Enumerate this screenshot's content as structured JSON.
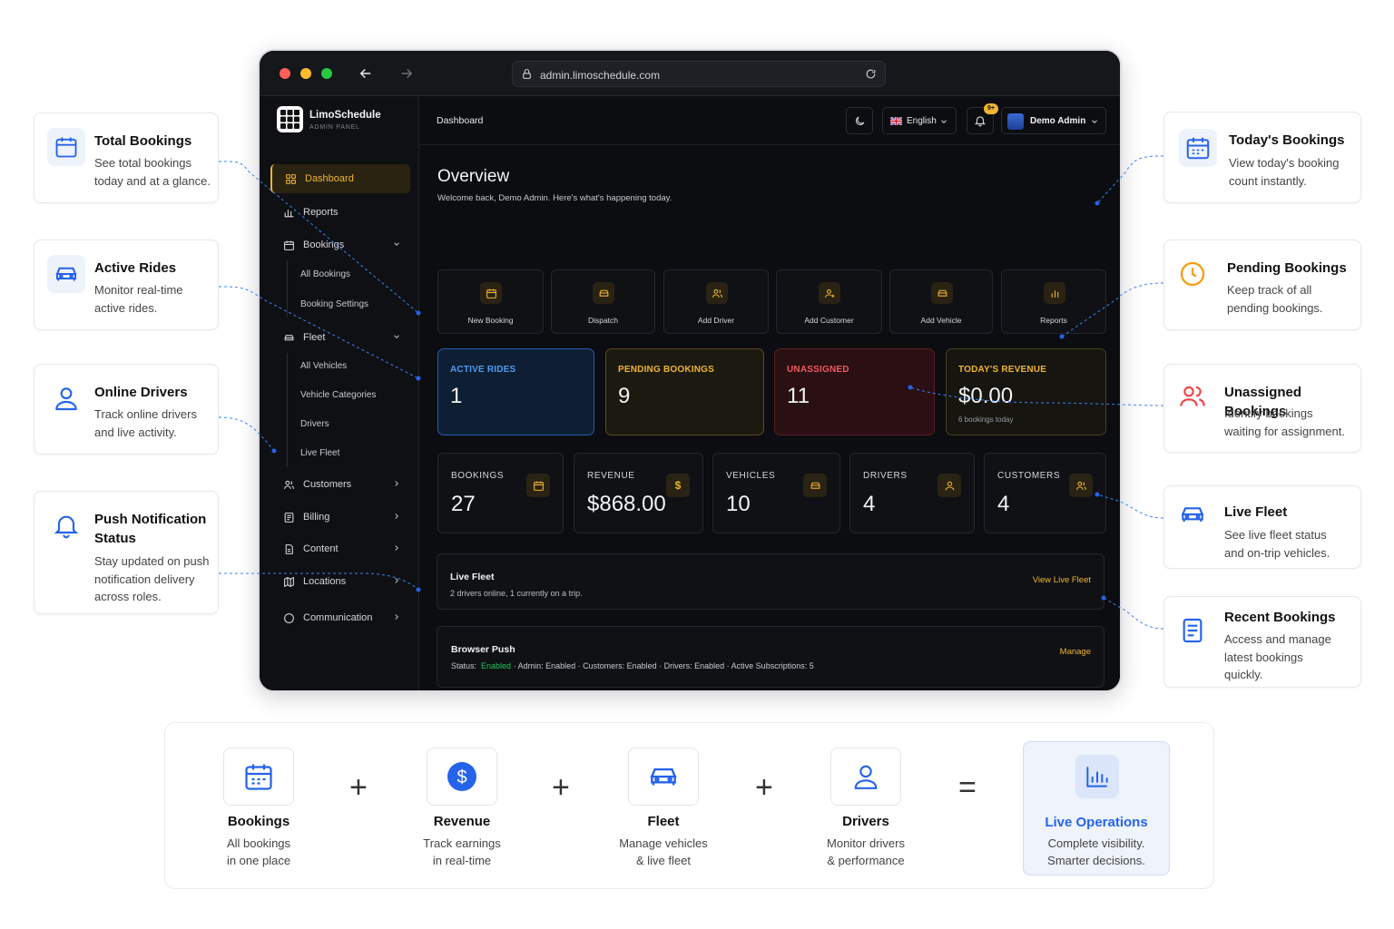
{
  "browser": {
    "url": "admin.limoschedule.com"
  },
  "brand": {
    "name": "LimoSchedule",
    "subtitle": "ADMIN PANEL"
  },
  "topbar": {
    "breadcrumb": "Dashboard",
    "language": "English",
    "notification_badge": "9+",
    "user": "Demo Admin"
  },
  "sidebar": {
    "dashboard": "Dashboard",
    "reports": "Reports",
    "bookings": "Bookings",
    "all_bookings": "All Bookings",
    "booking_settings": "Booking Settings",
    "fleet": "Fleet",
    "all_vehicles": "All Vehicles",
    "vehicle_categories": "Vehicle Categories",
    "drivers": "Drivers",
    "live_fleet": "Live Fleet",
    "customers": "Customers",
    "billing": "Billing",
    "content": "Content",
    "locations": "Locations",
    "communication": "Communication"
  },
  "overview": {
    "title": "Overview",
    "welcome": "Welcome back, Demo Admin. Here's what's happening today."
  },
  "quick_actions": {
    "new_booking": "New Booking",
    "dispatch": "Dispatch",
    "add_driver": "Add Driver",
    "add_customer": "Add Customer",
    "add_vehicle": "Add Vehicle",
    "reports": "Reports"
  },
  "status_cards": {
    "active_rides": {
      "label": "ACTIVE RIDES",
      "value": "1"
    },
    "pending": {
      "label": "PENDING BOOKINGS",
      "value": "9"
    },
    "unassigned": {
      "label": "UNASSIGNED",
      "value": "11"
    },
    "revenue": {
      "label": "TODAY'S REVENUE",
      "value": "$0.00",
      "sub": "6 bookings today"
    }
  },
  "metrics": {
    "bookings": {
      "label": "BOOKINGS",
      "value": "27"
    },
    "revenue": {
      "label": "REVENUE",
      "value": "$868.00"
    },
    "vehicles": {
      "label": "VEHICLES",
      "value": "10"
    },
    "drivers": {
      "label": "DRIVERS",
      "value": "4"
    },
    "customers": {
      "label": "CUSTOMERS",
      "value": "4"
    }
  },
  "live_fleet": {
    "title": "Live Fleet",
    "desc": "2 drivers online, 1 currently on a trip.",
    "action": "View Live Fleet"
  },
  "browser_push": {
    "title": "Browser Push",
    "status_prefix": "Status:",
    "status_value": "Enabled",
    "status_rest": " · Admin: Enabled · Customers: Enabled · Drivers: Enabled · Active Subscriptions: 5",
    "action": "Manage"
  },
  "callouts": {
    "total_bookings": {
      "title": "Total Bookings",
      "desc1": "See total bookings",
      "desc2": "today and at a glance."
    },
    "active_rides": {
      "title": "Active Rides",
      "desc1": "Monitor real-time",
      "desc2": "active rides."
    },
    "online_drivers": {
      "title": "Online Drivers",
      "desc1": "Track online drivers",
      "desc2": "and live activity."
    },
    "push": {
      "title1": "Push Notification",
      "title2": "Status",
      "desc1": "Stay updated on push",
      "desc2": "notification delivery",
      "desc3": "across roles."
    },
    "todays_bookings": {
      "title": "Today's Bookings",
      "desc1": "View today's booking",
      "desc2": "count instantly."
    },
    "pending": {
      "title": "Pending Bookings",
      "desc1": "Keep track of all",
      "desc2": "pending bookings."
    },
    "unassigned": {
      "title": "Unassigned Bookings",
      "desc1": "Identify bookings",
      "desc2": "waiting for assignment."
    },
    "live_fleet": {
      "title": "Live Fleet",
      "desc1": "See live fleet status",
      "desc2": "and on-trip vehicles."
    },
    "recent": {
      "title": "Recent Bookings",
      "desc1": "Access and manage",
      "desc2": "latest bookings",
      "desc3": "quickly."
    }
  },
  "bottom": {
    "bookings": {
      "title": "Bookings",
      "desc1": "All bookings",
      "desc2": "in one place"
    },
    "revenue": {
      "title": "Revenue",
      "desc1": "Track earnings",
      "desc2": "in real-time"
    },
    "fleet": {
      "title": "Fleet",
      "desc1": "Manage vehicles",
      "desc2": "& live fleet"
    },
    "drivers": {
      "title": "Drivers",
      "desc1": "Monitor drivers",
      "desc2": "& performance"
    },
    "live_ops": {
      "title": "Live Operations",
      "desc1": "Complete visibility.",
      "desc2": "Smarter decisions."
    },
    "plus": "+",
    "equals": "="
  },
  "colors": {
    "accent": "#f0b432",
    "blue": "#2563eb",
    "active": "#3b82f6",
    "danger": "#ef4444",
    "success": "#22c55e"
  }
}
